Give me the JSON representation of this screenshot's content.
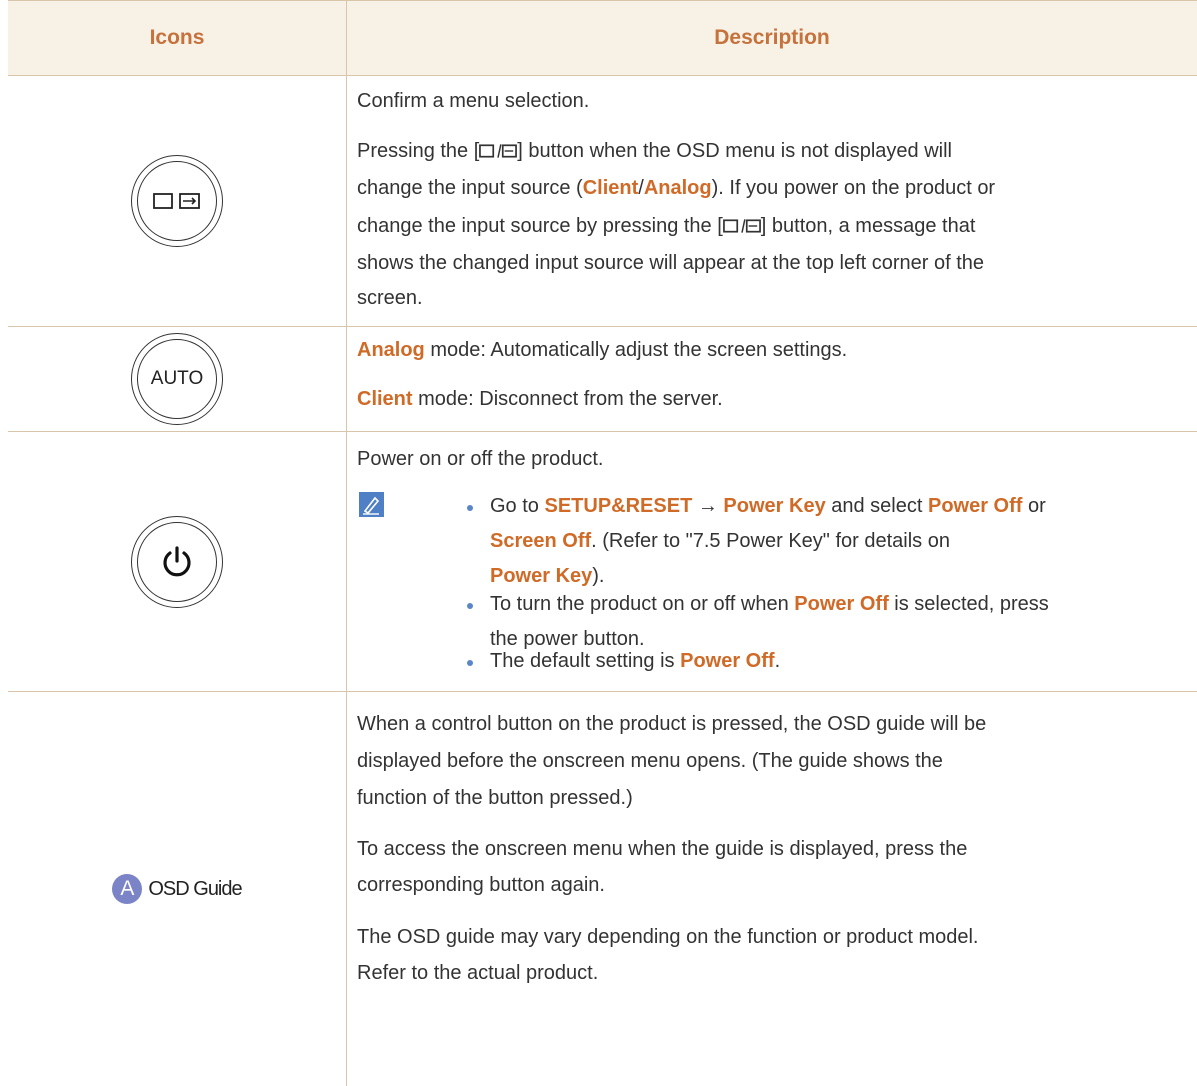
{
  "header": {
    "col_icons": "Icons",
    "col_description": "Description"
  },
  "row1": {
    "icon_name": "source-enter-icon",
    "p1": "Confirm a menu selection.",
    "p2a": "Pressing the [",
    "p2b": "] button when the OSD menu is not displayed will",
    "p3a": "change the input source (",
    "p3_client": "Client",
    "p3_slash": "/",
    "p3_analog": "Analog",
    "p3b": "). If you power on the product or",
    "p4a": "change the input source by pressing the [",
    "p4b": "] button, a message that",
    "p5": "shows the changed input source will appear at the top left corner of the",
    "p6": "screen."
  },
  "row2": {
    "icon_label": "AUTO",
    "l1_hl": "Analog",
    "l1": " mode: Automatically adjust the screen settings.",
    "l2_hl": "Client",
    "l2": " mode: Disconnect from the server."
  },
  "row3": {
    "icon_name": "power-icon",
    "p1": "Power on or off the product.",
    "b1_a": "Go to ",
    "b1_setup": "SETUP&RESET",
    "b1_arrow": " → ",
    "b1_pk": "Power Key",
    "b1_b": " and select ",
    "b1_po": "Power Off",
    "b1_c": " or",
    "b1_so": "Screen Off",
    "b1_d": ". (Refer to \"7.5 Power Key\" for details on",
    "b1_pk2": "Power Key",
    "b1_e": ").",
    "b2_a": "To turn the product on or off when ",
    "b2_po": "Power Off",
    "b2_b": " is selected, press",
    "b2_c": "the power button.",
    "b3_a": "The default setting is ",
    "b3_po": "Power Off",
    "b3_b": "."
  },
  "row4": {
    "icon_letter": "A",
    "icon_label": "OSD Guide",
    "l1": "When a control button on the product is pressed, the OSD guide will be",
    "l2": "displayed before the onscreen menu opens. (The guide shows the",
    "l3": "function of the button pressed.)",
    "l4": "To access the onscreen menu when the guide is displayed, press the",
    "l5": "corresponding button again.",
    "l6": "The OSD guide may vary depending on the function or product model.",
    "l7": "Refer to the actual product."
  },
  "colors": {
    "accent": "#d06a27",
    "header_bg": "#f8f1e6",
    "border": "#d8c6ab",
    "bullet": "#5a86c8",
    "guide_icon": "#7c84c8"
  }
}
